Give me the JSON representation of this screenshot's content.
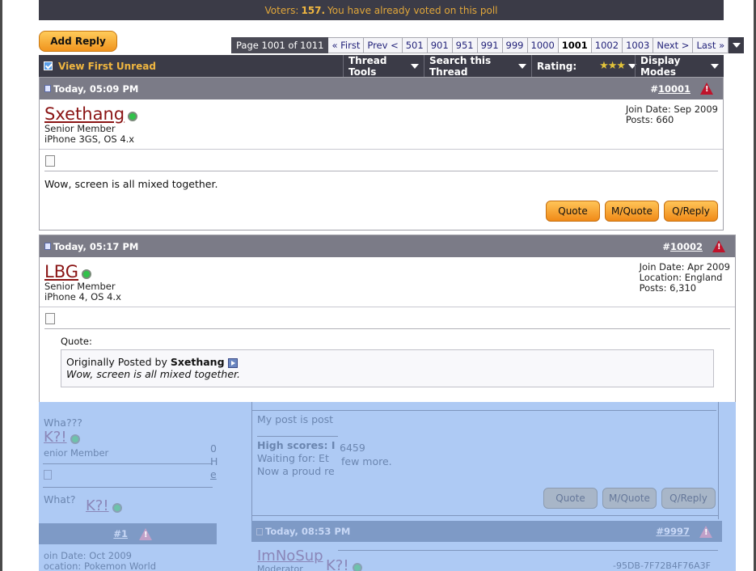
{
  "poll": {
    "prefix": "Voters:",
    "count": "157.",
    "suffix": "You have already voted on this poll"
  },
  "add_reply": "Add Reply",
  "pager": {
    "label": "Page 1001 of 1011",
    "links": [
      "« First",
      "Prev <",
      "501",
      "901",
      "951",
      "991",
      "999",
      "1000",
      "1001",
      "1002",
      "1003",
      "Next >",
      "Last »"
    ],
    "current": "1001"
  },
  "toolbar": {
    "view_first_unread": "View First Unread",
    "thread_tools": "Thread Tools",
    "search_thread": "Search this Thread",
    "rating": "Rating:",
    "rating_stars": "★★★",
    "display_modes": "Display Modes"
  },
  "posts": [
    {
      "date": "Today, 05:09 PM",
      "hash": "#",
      "number": "10001",
      "username": "Sxethang",
      "title": "Senior Member",
      "device": "iPhone 3GS, OS 4.x",
      "info": [
        "Join Date: Sep 2009",
        "Posts: 660"
      ],
      "message": "Wow, screen is all mixed together.",
      "buttons": [
        "Quote",
        "M/Quote",
        "Q/Reply"
      ]
    },
    {
      "date": "Today, 05:17 PM",
      "hash": "#",
      "number": "10002",
      "username": "LBG",
      "title": "Senior Member",
      "device": "iPhone 4, OS 4.x",
      "info": [
        "Join Date: Apr 2009",
        "Location: England",
        "Posts: 6,310"
      ],
      "quote_label": "Quote:",
      "quote_prefix": "Originally Posted by",
      "quote_author": "Sxethang",
      "quote_text": "Wow, screen is all mixed together."
    }
  ],
  "glitch": {
    "wha": "Wha???",
    "k1": "K?!",
    "senior": "enior Member",
    "zero": "0",
    "h": "H",
    "e": "e",
    "what": "What?",
    "k2": "K?!",
    "num1": "#1",
    "join": "oin Date: Oct 2009",
    "loc": "ocation: Pokemon World",
    "mypost": "My post is post",
    "high": "High scores: I",
    "score": "6459",
    "waiting": "Waiting for: Et",
    "few": "few more.",
    "proud": "Now a proud re",
    "quote": "Quote",
    "mquote": "M/Quote",
    "qreply": "Q/Reply",
    "date": "Today, 08:53 PM",
    "num9997": "9997",
    "imno": "ImNoSup",
    "k3": "K?!",
    "hex": "-95DB-7F72B4F76A3F",
    "mod": "Moderator"
  }
}
